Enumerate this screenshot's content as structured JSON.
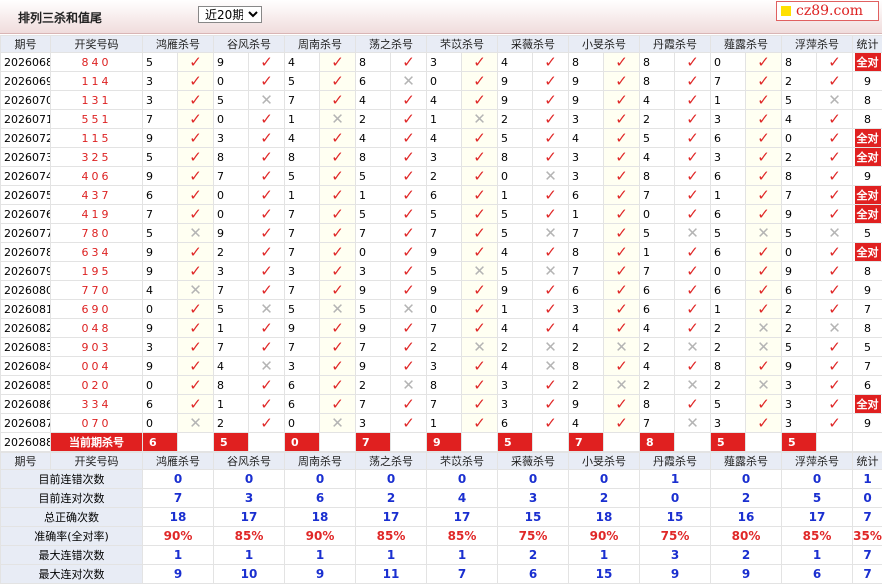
{
  "header": {
    "title": "排列三杀和值尾",
    "period_select": "近20期",
    "brand": "cz89.com"
  },
  "columns": [
    "期号",
    "开奖号码",
    "鸿雁杀号",
    "谷风杀号",
    "周南杀号",
    "荡之杀号",
    "芣苡杀号",
    "采薇杀号",
    "小旻杀号",
    "丹霞杀号",
    "薤露杀号",
    "浮萍杀号",
    "统计"
  ],
  "all_label": "全对",
  "current_label": "当前期杀号",
  "rows": [
    {
      "issue": "2026068",
      "draw": "840",
      "picks": [
        5,
        9,
        4,
        8,
        3,
        4,
        8,
        8,
        0,
        8
      ],
      "total": "全对"
    },
    {
      "issue": "2026069",
      "draw": "114",
      "picks": [
        3,
        0,
        5,
        6,
        0,
        9,
        9,
        8,
        7,
        2
      ],
      "total": "9"
    },
    {
      "issue": "2026070",
      "draw": "131",
      "picks": [
        3,
        5,
        7,
        4,
        4,
        9,
        9,
        4,
        1,
        5
      ],
      "total": "8"
    },
    {
      "issue": "2026071",
      "draw": "551",
      "picks": [
        7,
        0,
        1,
        2,
        1,
        2,
        3,
        2,
        3,
        4
      ],
      "total": "8"
    },
    {
      "issue": "2026072",
      "draw": "115",
      "picks": [
        9,
        3,
        4,
        4,
        4,
        5,
        4,
        5,
        6,
        0
      ],
      "total": "全对"
    },
    {
      "issue": "2026073",
      "draw": "325",
      "picks": [
        5,
        8,
        8,
        8,
        3,
        8,
        3,
        4,
        3,
        2
      ],
      "total": "全对"
    },
    {
      "issue": "2026074",
      "draw": "406",
      "picks": [
        9,
        7,
        5,
        5,
        2,
        0,
        3,
        8,
        6,
        8
      ],
      "total": "9"
    },
    {
      "issue": "2026075",
      "draw": "437",
      "picks": [
        6,
        0,
        1,
        1,
        6,
        1,
        6,
        7,
        1,
        7
      ],
      "total": "全对"
    },
    {
      "issue": "2026076",
      "draw": "419",
      "picks": [
        7,
        0,
        7,
        5,
        5,
        5,
        1,
        0,
        6,
        9
      ],
      "total": "全对"
    },
    {
      "issue": "2026077",
      "draw": "780",
      "picks": [
        5,
        9,
        7,
        7,
        7,
        5,
        7,
        5,
        5,
        5
      ],
      "total": "5"
    },
    {
      "issue": "2026078",
      "draw": "634",
      "picks": [
        9,
        2,
        7,
        0,
        9,
        4,
        8,
        1,
        6,
        0
      ],
      "total": "全对"
    },
    {
      "issue": "2026079",
      "draw": "195",
      "picks": [
        9,
        3,
        3,
        3,
        5,
        5,
        7,
        7,
        0,
        9
      ],
      "total": "8"
    },
    {
      "issue": "2026080",
      "draw": "770",
      "picks": [
        4,
        7,
        7,
        9,
        9,
        9,
        6,
        6,
        6,
        6
      ],
      "total": "9"
    },
    {
      "issue": "2026081",
      "draw": "690",
      "picks": [
        0,
        5,
        5,
        5,
        0,
        1,
        3,
        6,
        1,
        2
      ],
      "total": "7"
    },
    {
      "issue": "2026082",
      "draw": "048",
      "picks": [
        9,
        1,
        9,
        9,
        7,
        4,
        4,
        4,
        2,
        2
      ],
      "total": "8"
    },
    {
      "issue": "2026083",
      "draw": "903",
      "picks": [
        3,
        7,
        7,
        7,
        2,
        2,
        2,
        2,
        2,
        5
      ],
      "total": "5"
    },
    {
      "issue": "2026084",
      "draw": "004",
      "picks": [
        9,
        4,
        3,
        9,
        3,
        4,
        8,
        4,
        8,
        9
      ],
      "total": "7"
    },
    {
      "issue": "2026085",
      "draw": "020",
      "picks": [
        0,
        8,
        6,
        2,
        8,
        3,
        2,
        2,
        2,
        3
      ],
      "total": "6"
    },
    {
      "issue": "2026086",
      "draw": "334",
      "picks": [
        6,
        1,
        6,
        7,
        7,
        3,
        9,
        8,
        5,
        3
      ],
      "total": "全对"
    },
    {
      "issue": "2026087",
      "draw": "070",
      "picks": [
        0,
        2,
        0,
        3,
        1,
        6,
        4,
        7,
        3,
        3
      ],
      "total": "9"
    }
  ],
  "marks": [
    [
      "hit",
      "hit",
      "hit",
      "hit",
      "hit",
      "hit",
      "hit",
      "hit",
      "hit",
      "hit"
    ],
    [
      "hit",
      "hit",
      "hit",
      "miss",
      "hit",
      "hit",
      "hit",
      "hit",
      "hit",
      "hit"
    ],
    [
      "hit",
      "miss",
      "hit",
      "hit",
      "hit",
      "hit",
      "hit",
      "hit",
      "hit",
      "miss"
    ],
    [
      "hit",
      "hit",
      "miss",
      "hit",
      "miss",
      "hit",
      "hit",
      "hit",
      "hit",
      "hit"
    ],
    [
      "hit",
      "hit",
      "hit",
      "hit",
      "hit",
      "hit",
      "hit",
      "hit",
      "hit",
      "hit"
    ],
    [
      "hit",
      "hit",
      "hit",
      "hit",
      "hit",
      "hit",
      "hit",
      "hit",
      "hit",
      "hit"
    ],
    [
      "hit",
      "hit",
      "hit",
      "hit",
      "hit",
      "miss",
      "hit",
      "hit",
      "hit",
      "hit"
    ],
    [
      "hit",
      "hit",
      "hit",
      "hit",
      "hit",
      "hit",
      "hit",
      "hit",
      "hit",
      "hit"
    ],
    [
      "hit",
      "hit",
      "hit",
      "hit",
      "hit",
      "hit",
      "hit",
      "hit",
      "hit",
      "hit"
    ],
    [
      "miss",
      "hit",
      "hit",
      "hit",
      "hit",
      "miss",
      "hit",
      "miss",
      "miss",
      "miss"
    ],
    [
      "hit",
      "hit",
      "hit",
      "hit",
      "hit",
      "hit",
      "hit",
      "hit",
      "hit",
      "hit"
    ],
    [
      "hit",
      "hit",
      "hit",
      "hit",
      "miss",
      "miss",
      "hit",
      "hit",
      "hit",
      "hit"
    ],
    [
      "miss",
      "hit",
      "hit",
      "hit",
      "hit",
      "hit",
      "hit",
      "hit",
      "hit",
      "hit"
    ],
    [
      "hit",
      "miss",
      "miss",
      "miss",
      "hit",
      "hit",
      "hit",
      "hit",
      "hit",
      "hit"
    ],
    [
      "hit",
      "hit",
      "hit",
      "hit",
      "hit",
      "hit",
      "hit",
      "hit",
      "miss",
      "miss"
    ],
    [
      "hit",
      "hit",
      "hit",
      "hit",
      "miss",
      "miss",
      "miss",
      "miss",
      "miss",
      "hit"
    ],
    [
      "hit",
      "miss",
      "hit",
      "hit",
      "hit",
      "miss",
      "hit",
      "hit",
      "hit",
      "hit"
    ],
    [
      "hit",
      "hit",
      "hit",
      "miss",
      "hit",
      "hit",
      "miss",
      "miss",
      "miss",
      "hit"
    ],
    [
      "hit",
      "hit",
      "hit",
      "hit",
      "hit",
      "hit",
      "hit",
      "hit",
      "hit",
      "hit"
    ],
    [
      "miss",
      "hit",
      "miss",
      "hit",
      "hit",
      "hit",
      "hit",
      "miss",
      "hit",
      "hit"
    ]
  ],
  "current": {
    "issue": "2026088",
    "picks": [
      "6",
      "5",
      "0",
      "7",
      "9",
      "5",
      "7",
      "8",
      "5",
      "5"
    ]
  },
  "stats_header": [
    "期号",
    "开奖号码",
    "鸿雁杀号",
    "谷风杀号",
    "周南杀号",
    "荡之杀号",
    "芣苡杀号",
    "采薇杀号",
    "小旻杀号",
    "丹霞杀号",
    "薤露杀号",
    "浮萍杀号",
    "统计"
  ],
  "stats": [
    {
      "label": "目前连错次数",
      "values": [
        "0",
        "0",
        "0",
        "0",
        "0",
        "0",
        "0",
        "1",
        "0",
        "0",
        "1"
      ]
    },
    {
      "label": "目前连对次数",
      "values": [
        "7",
        "3",
        "6",
        "2",
        "4",
        "3",
        "2",
        "0",
        "2",
        "5",
        "0"
      ]
    },
    {
      "label": "总正确次数",
      "values": [
        "18",
        "17",
        "18",
        "17",
        "17",
        "15",
        "18",
        "15",
        "16",
        "17",
        "7"
      ]
    },
    {
      "label": "准确率(全对率)",
      "values": [
        "90%",
        "85%",
        "90%",
        "85%",
        "85%",
        "75%",
        "90%",
        "75%",
        "80%",
        "85%",
        "35%"
      ]
    },
    {
      "label": "最大连错次数",
      "values": [
        "1",
        "1",
        "1",
        "1",
        "1",
        "2",
        "1",
        "3",
        "2",
        "1",
        "7"
      ]
    },
    {
      "label": "最大连对次数",
      "values": [
        "9",
        "10",
        "9",
        "11",
        "7",
        "6",
        "15",
        "9",
        "9",
        "6",
        "7"
      ]
    }
  ],
  "colors": {
    "hit": "#e02828",
    "miss": "#b4b4b4",
    "accent": "#e02020",
    "blue": "#1a2fd0"
  }
}
